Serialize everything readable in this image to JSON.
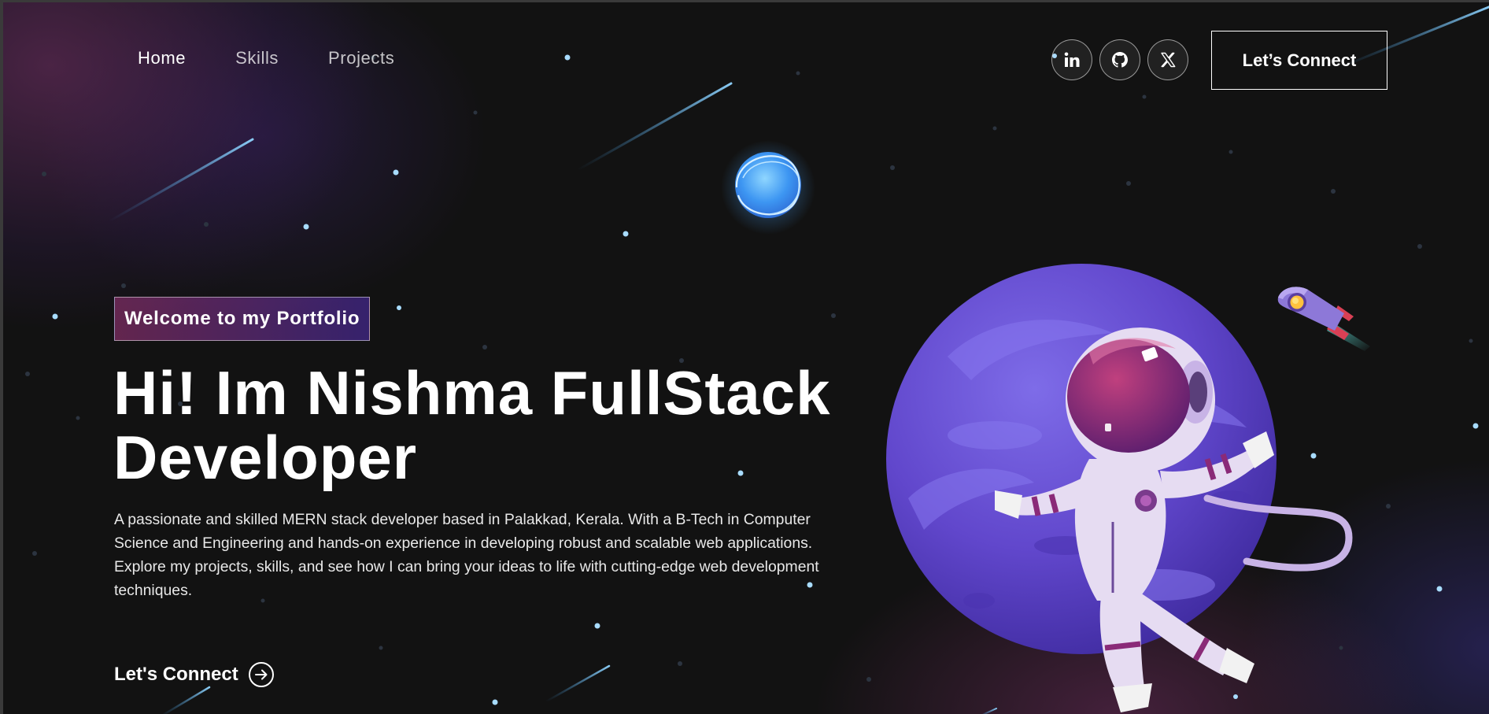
{
  "nav": {
    "links": [
      {
        "label": "Home",
        "active": true
      },
      {
        "label": "Skills",
        "active": false
      },
      {
        "label": "Projects",
        "active": false
      }
    ],
    "socials": [
      {
        "name": "linkedin-icon",
        "label": "in"
      },
      {
        "name": "github-icon"
      },
      {
        "name": "x-icon"
      }
    ],
    "connect_label": "Let’s Connect"
  },
  "hero": {
    "tagline": "Welcome to my Portfolio",
    "headline_line1": "Hi! Im Nishma FullStack",
    "headline_line2": "Developer",
    "intro": "A passionate and skilled MERN stack developer based in Palakkad, Kerala. With a B-Tech in Computer Science and Engineering and hands-on experience in developing robust and scalable web applications. Explore my projects, skills, and see how I can bring your ideas to life with cutting-edge web development techniques.",
    "cta_label": "Let's Connect"
  },
  "illustration": {
    "planet_color": "#6b4bd1",
    "astronaut_suit_color": "#e6dcf2",
    "visor_color": "#8a2a78",
    "glow_planet_color": "#4aa8ff"
  },
  "colors": {
    "background": "#121212",
    "tagline_gradient_start": "#aa367c",
    "tagline_gradient_end": "#4a2fbd"
  }
}
